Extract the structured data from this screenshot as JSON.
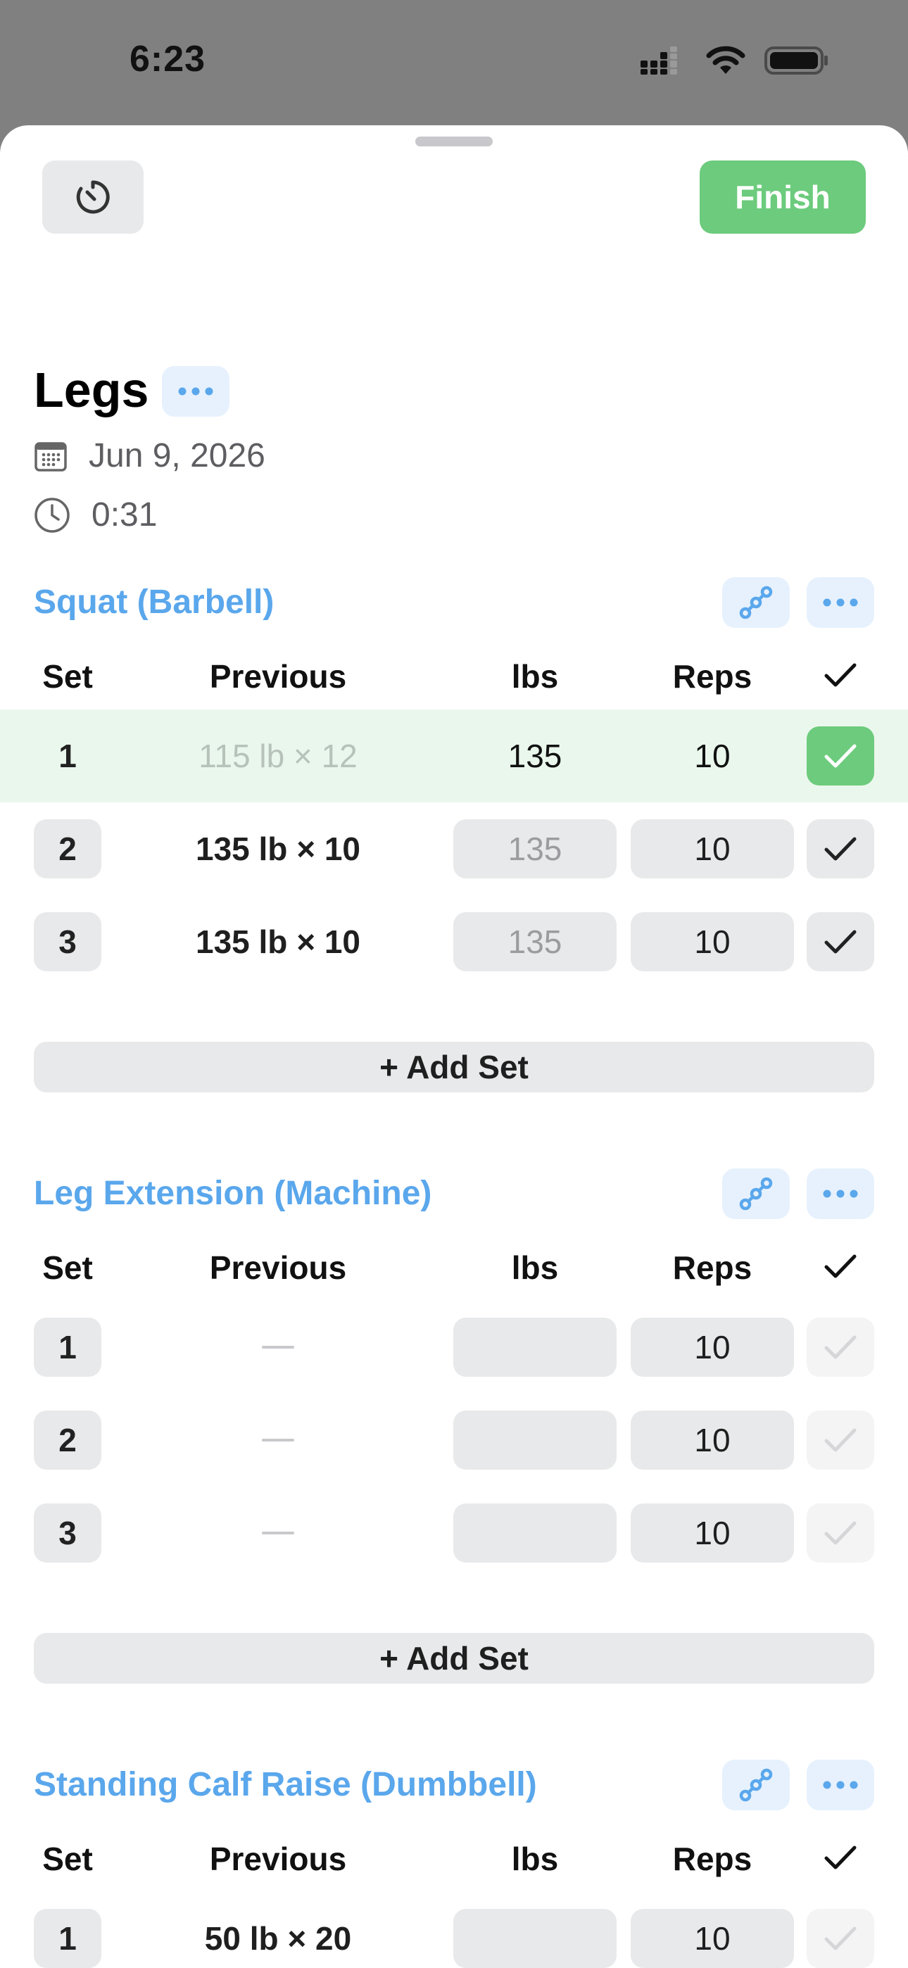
{
  "status_bar": {
    "time": "6:23"
  },
  "header": {
    "finish_label": "Finish"
  },
  "workout": {
    "title": "Legs",
    "date": "Jun 9, 2026",
    "duration": "0:31"
  },
  "table_headers": {
    "set": "Set",
    "previous": "Previous",
    "lbs": "lbs",
    "reps": "Reps"
  },
  "add_set_label": "+ Add Set",
  "exercises": [
    {
      "name": "Squat (Barbell)",
      "sets": [
        {
          "set": "1",
          "previous": "115 lb × 12",
          "lbs": "135",
          "reps": "10",
          "completed": true
        },
        {
          "set": "2",
          "previous": "135 lb × 10",
          "lbs": "135",
          "reps": "10",
          "completed": false
        },
        {
          "set": "3",
          "previous": "135 lb × 10",
          "lbs": "135",
          "reps": "10",
          "completed": false
        }
      ]
    },
    {
      "name": "Leg Extension (Machine)",
      "sets": [
        {
          "set": "1",
          "previous": "",
          "lbs": "",
          "reps": "10",
          "completed": false
        },
        {
          "set": "2",
          "previous": "",
          "lbs": "",
          "reps": "10",
          "completed": false
        },
        {
          "set": "3",
          "previous": "",
          "lbs": "",
          "reps": "10",
          "completed": false
        }
      ]
    },
    {
      "name": "Standing Calf Raise (Dumbbell)",
      "sets": [
        {
          "set": "1",
          "previous": "50 lb × 20",
          "lbs": "",
          "reps": "10",
          "completed": false
        }
      ]
    }
  ],
  "colors": {
    "accent": "#5aa7ec",
    "success": "#6ccb7c"
  }
}
